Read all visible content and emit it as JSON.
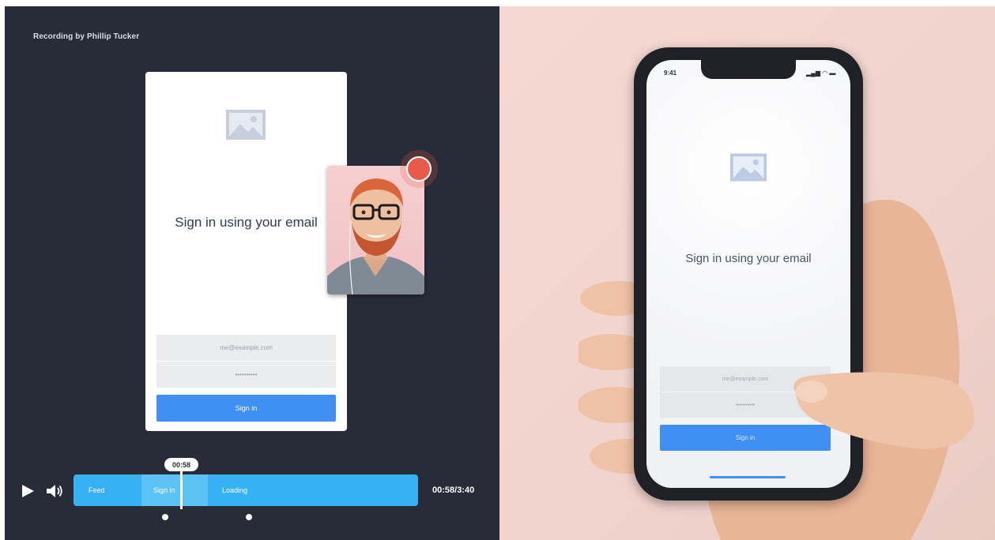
{
  "recording": {
    "title": "Recording by Phillip Tucker"
  },
  "card": {
    "heading": "Sign in using your email",
    "email_placeholder": "me@example.com",
    "password_value": "••••••••••",
    "sign_in_label": "Sign in"
  },
  "player": {
    "current_time": "00:58",
    "time_display": "00:58/3:40",
    "segments": [
      "Feed",
      "Sign in",
      "Loading"
    ]
  },
  "phone": {
    "status_time": "9:41",
    "heading": "Sign in using your email",
    "email_placeholder": "me@example.com",
    "password_value": "••••••••••",
    "sign_in_label": "Sign in"
  },
  "colors": {
    "accent": "#3f8ff5",
    "timeline": "#37b1f4",
    "record": "#ea5a4b",
    "panel_bg": "#272c38"
  }
}
